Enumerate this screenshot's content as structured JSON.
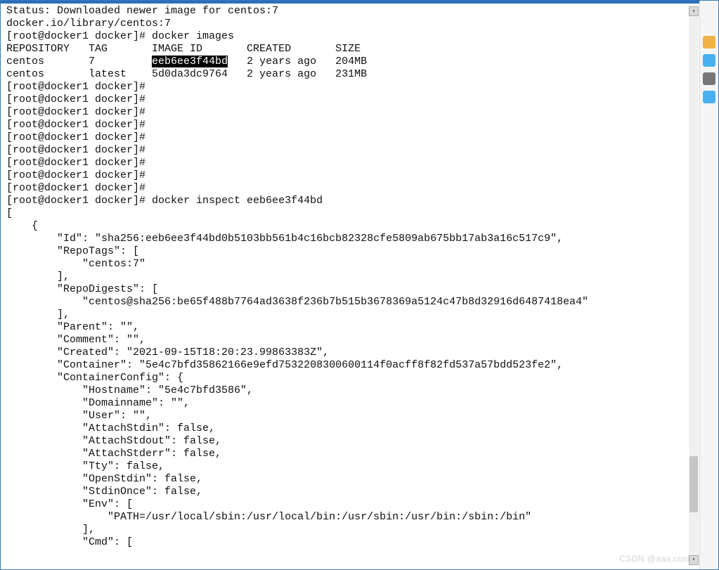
{
  "lines": [
    {
      "t": "Status: Downloaded newer image for centos:7"
    },
    {
      "t": "docker.io/library/centos:7"
    },
    {
      "t": "[root@docker1 docker]# docker images"
    },
    {
      "t": "REPOSITORY   TAG       IMAGE ID       CREATED       SIZE"
    },
    {
      "pre": "centos       7         ",
      "hl": "eeb6ee3f44bd",
      "post": "   2 years ago   204MB"
    },
    {
      "t": "centos       latest    5d0da3dc9764   2 years ago   231MB"
    },
    {
      "t": "[root@docker1 docker]#"
    },
    {
      "t": "[root@docker1 docker]#"
    },
    {
      "t": "[root@docker1 docker]#"
    },
    {
      "t": "[root@docker1 docker]#"
    },
    {
      "t": "[root@docker1 docker]#"
    },
    {
      "t": "[root@docker1 docker]#"
    },
    {
      "t": "[root@docker1 docker]#"
    },
    {
      "t": "[root@docker1 docker]#"
    },
    {
      "t": "[root@docker1 docker]#"
    },
    {
      "t": "[root@docker1 docker]# docker inspect eeb6ee3f44bd"
    },
    {
      "t": "["
    },
    {
      "t": "    {"
    },
    {
      "t": "        \"Id\": \"sha256:eeb6ee3f44bd0b5103bb561b4c16bcb82328cfe5809ab675bb17ab3a16c517c9\","
    },
    {
      "t": "        \"RepoTags\": ["
    },
    {
      "t": "            \"centos:7\""
    },
    {
      "t": "        ],"
    },
    {
      "t": "        \"RepoDigests\": ["
    },
    {
      "t": "            \"centos@sha256:be65f488b7764ad3638f236b7b515b3678369a5124c47b8d32916d6487418ea4\""
    },
    {
      "t": "        ],"
    },
    {
      "t": "        \"Parent\": \"\","
    },
    {
      "t": "        \"Comment\": \"\","
    },
    {
      "t": "        \"Created\": \"2021-09-15T18:20:23.99863383Z\","
    },
    {
      "t": "        \"Container\": \"5e4c7bfd35862166e9efd7532208300600114f0acff8f82fd537a57bdd523fe2\","
    },
    {
      "t": "        \"ContainerConfig\": {"
    },
    {
      "t": "            \"Hostname\": \"5e4c7bfd3586\","
    },
    {
      "t": "            \"Domainname\": \"\","
    },
    {
      "t": "            \"User\": \"\","
    },
    {
      "t": "            \"AttachStdin\": false,"
    },
    {
      "t": "            \"AttachStdout\": false,"
    },
    {
      "t": "            \"AttachStderr\": false,"
    },
    {
      "t": "            \"Tty\": false,"
    },
    {
      "t": "            \"OpenStdin\": false,"
    },
    {
      "t": "            \"StdinOnce\": false,"
    },
    {
      "t": "            \"Env\": ["
    },
    {
      "t": "                \"PATH=/usr/local/sbin:/usr/local/bin:/usr/sbin:/usr/bin:/sbin:/bin\""
    },
    {
      "t": "            ],"
    },
    {
      "t": "            \"Cmd\": ["
    }
  ],
  "watermark": "CSDN @aaa.com"
}
